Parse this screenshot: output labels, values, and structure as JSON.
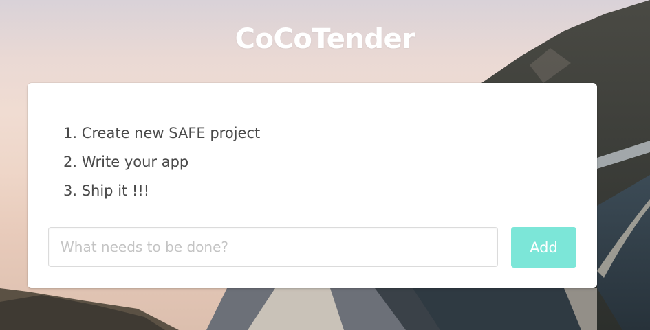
{
  "header": {
    "title": "CoCoTender"
  },
  "todos": {
    "items": [
      {
        "label": "1. Create new SAFE project"
      },
      {
        "label": "2. Write your app"
      },
      {
        "label": "3. Ship it !!!"
      }
    ]
  },
  "new_todo": {
    "value": "",
    "placeholder": "What needs to be done?"
  },
  "add_button": {
    "label": "Add"
  },
  "colors": {
    "accent": "#7ce6d8",
    "card_bg": "#ffffff",
    "text": "#4a4a4a",
    "title": "#ffffff"
  }
}
